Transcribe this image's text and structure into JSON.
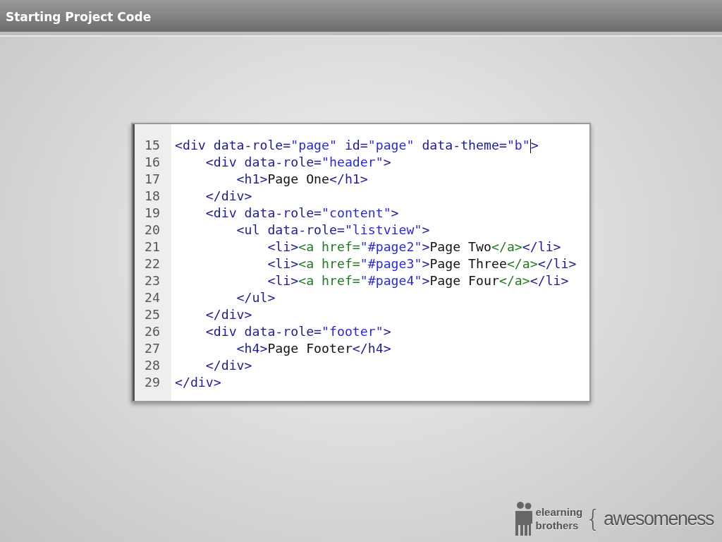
{
  "title": "Starting Project Code",
  "code": {
    "lines": [
      {
        "number": "15",
        "segments": [
          {
            "kind": "tag",
            "text": "<div data-role="
          },
          {
            "kind": "string",
            "text": "\"page\""
          },
          {
            "kind": "tag",
            "text": " id="
          },
          {
            "kind": "string",
            "text": "\"page\""
          },
          {
            "kind": "tag",
            "text": " data-theme="
          },
          {
            "kind": "string",
            "text": "\"b\""
          },
          {
            "kind": "cursor"
          },
          {
            "kind": "tag",
            "text": ">"
          }
        ]
      },
      {
        "number": "16",
        "segments": [
          {
            "kind": "tag",
            "text": "    <div data-role="
          },
          {
            "kind": "string",
            "text": "\"header\""
          },
          {
            "kind": "tag",
            "text": ">"
          }
        ]
      },
      {
        "number": "17",
        "segments": [
          {
            "kind": "tag",
            "text": "        <h1>"
          },
          {
            "kind": "text",
            "text": "Page One"
          },
          {
            "kind": "tag",
            "text": "</h1>"
          }
        ]
      },
      {
        "number": "18",
        "segments": [
          {
            "kind": "tag",
            "text": "    </div>"
          }
        ]
      },
      {
        "number": "19",
        "segments": [
          {
            "kind": "tag",
            "text": "    <div data-role="
          },
          {
            "kind": "string",
            "text": "\"content\""
          },
          {
            "kind": "tag",
            "text": ">"
          }
        ]
      },
      {
        "number": "20",
        "segments": [
          {
            "kind": "tag",
            "text": "        <ul data-role="
          },
          {
            "kind": "string",
            "text": "\"listview\""
          },
          {
            "kind": "tag",
            "text": ">"
          }
        ]
      },
      {
        "number": "21",
        "segments": [
          {
            "kind": "tag",
            "text": "            <li>"
          },
          {
            "kind": "link",
            "text": "<a href="
          },
          {
            "kind": "string",
            "text": "\"#page2\""
          },
          {
            "kind": "tag",
            "text": ">"
          },
          {
            "kind": "text",
            "text": "Page Two"
          },
          {
            "kind": "link",
            "text": "</a>"
          },
          {
            "kind": "tag",
            "text": "</li>"
          }
        ]
      },
      {
        "number": "22",
        "segments": [
          {
            "kind": "tag",
            "text": "            <li>"
          },
          {
            "kind": "link",
            "text": "<a href="
          },
          {
            "kind": "string",
            "text": "\"#page3\""
          },
          {
            "kind": "tag",
            "text": ">"
          },
          {
            "kind": "text",
            "text": "Page Three"
          },
          {
            "kind": "link",
            "text": "</a>"
          },
          {
            "kind": "tag",
            "text": "</li>"
          }
        ]
      },
      {
        "number": "23",
        "segments": [
          {
            "kind": "tag",
            "text": "            <li>"
          },
          {
            "kind": "link",
            "text": "<a href="
          },
          {
            "kind": "string",
            "text": "\"#page4\""
          },
          {
            "kind": "tag",
            "text": ">"
          },
          {
            "kind": "text",
            "text": "Page Four"
          },
          {
            "kind": "link",
            "text": "</a>"
          },
          {
            "kind": "tag",
            "text": "</li>"
          }
        ]
      },
      {
        "number": "24",
        "segments": [
          {
            "kind": "tag",
            "text": "        </ul>"
          }
        ]
      },
      {
        "number": "25",
        "segments": [
          {
            "kind": "tag",
            "text": "    </div>"
          }
        ]
      },
      {
        "number": "26",
        "segments": [
          {
            "kind": "tag",
            "text": "    <div data-role="
          },
          {
            "kind": "string",
            "text": "\"footer\""
          },
          {
            "kind": "tag",
            "text": ">"
          }
        ]
      },
      {
        "number": "27",
        "segments": [
          {
            "kind": "tag",
            "text": "        <h4>"
          },
          {
            "kind": "text",
            "text": "Page Footer"
          },
          {
            "kind": "tag",
            "text": "</h4>"
          }
        ]
      },
      {
        "number": "28",
        "segments": [
          {
            "kind": "tag",
            "text": "    </div>"
          }
        ]
      },
      {
        "number": "29",
        "segments": [
          {
            "kind": "tag",
            "text": "</div>"
          }
        ]
      }
    ]
  },
  "logo": {
    "brand_top": "elearning",
    "brand_bottom": "brothers",
    "brace": "{",
    "word": "awesomeness"
  }
}
